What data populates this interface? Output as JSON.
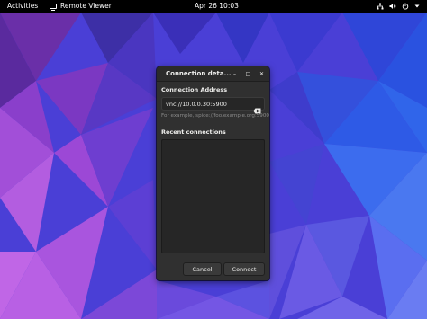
{
  "colors": {
    "topbar": "#000000",
    "dialog_bg": "#303030",
    "entry_bg": "#262626",
    "hint_text": "#8a8a8a",
    "wallpaper_base": "#4a3fd6"
  },
  "topbar": {
    "activities": "Activities",
    "app_name": "Remote Viewer",
    "app_icon": "remote-viewer-icon",
    "clock": "Apr 26  10:03",
    "status_icons": [
      "network-icon",
      "volume-icon",
      "power-icon",
      "chevron-down-icon"
    ]
  },
  "dialog": {
    "title": "Connection deta...",
    "window_buttons": {
      "minimize": "–",
      "maximize": "□",
      "close": "✕"
    },
    "address_label": "Connection Address",
    "address_value": "vnc://10.0.0.30:5900",
    "clear_icon": "backspace-clear-icon",
    "hint": "For example, spice://foo.example.org:5900",
    "recent_label": "Recent connections",
    "recent_items": [],
    "cancel": "Cancel",
    "connect": "Connect"
  }
}
